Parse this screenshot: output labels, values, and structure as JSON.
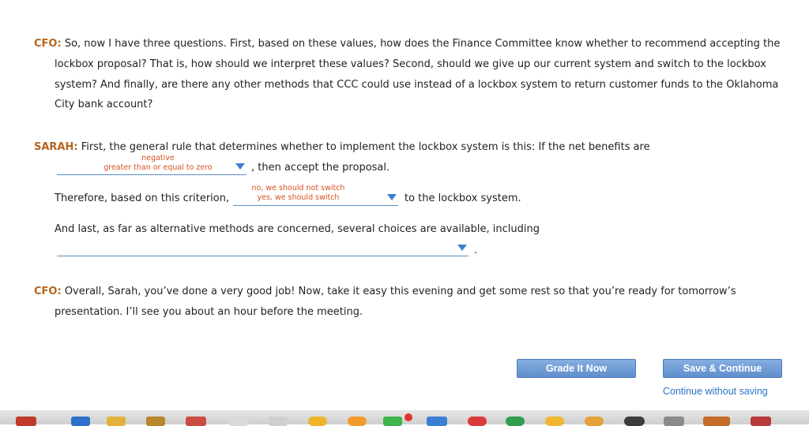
{
  "cfo_intro": {
    "speaker": "CFO:",
    "line1": "So, now I have three questions. First, based on these values, how does the Finance Committee know whether to recommend accepting the",
    "line2": "lockbox proposal? That is, how should we interpret these values? Second, should we give up our current system and switch to the lockbox",
    "line3": "system? And finally, are there any other methods that CCC could use instead of a lockbox system to return customer funds to the Oklahoma",
    "line4": "City bank account?"
  },
  "sarah": {
    "speaker": "SARAH:",
    "line1": "First, the general rule that determines whether to implement the lockbox system is this: If the net benefits are",
    "after_dropdown1": ", then accept the proposal.",
    "therefore": "Therefore, based on this criterion,",
    "after_dropdown2": "to the lockbox system.",
    "alternatives": "And last, as far as alternative methods are concerned, several choices are available, including",
    "after_dropdown3": "."
  },
  "dropdown1": {
    "options": [
      "negative",
      "greater than or equal to zero"
    ]
  },
  "dropdown2": {
    "options": [
      "no, we should not switch",
      "yes, we should switch"
    ]
  },
  "cfo_closing": {
    "speaker": "CFO:",
    "line1": "Overall, Sarah, you’ve done a very good job! Now, take it easy this evening and get some rest so that you’re ready for tomorrow’s",
    "line2": "presentation. I’ll see you about an hour before the meeting."
  },
  "buttons": {
    "grade": "Grade It Now",
    "save": "Save & Continue",
    "continue_link": "Continue without saving"
  },
  "colors": {
    "speaker": "#b5651d",
    "option_text": "#d9501e",
    "accent": "#3e7fd1",
    "button": "#6f9bd4"
  }
}
